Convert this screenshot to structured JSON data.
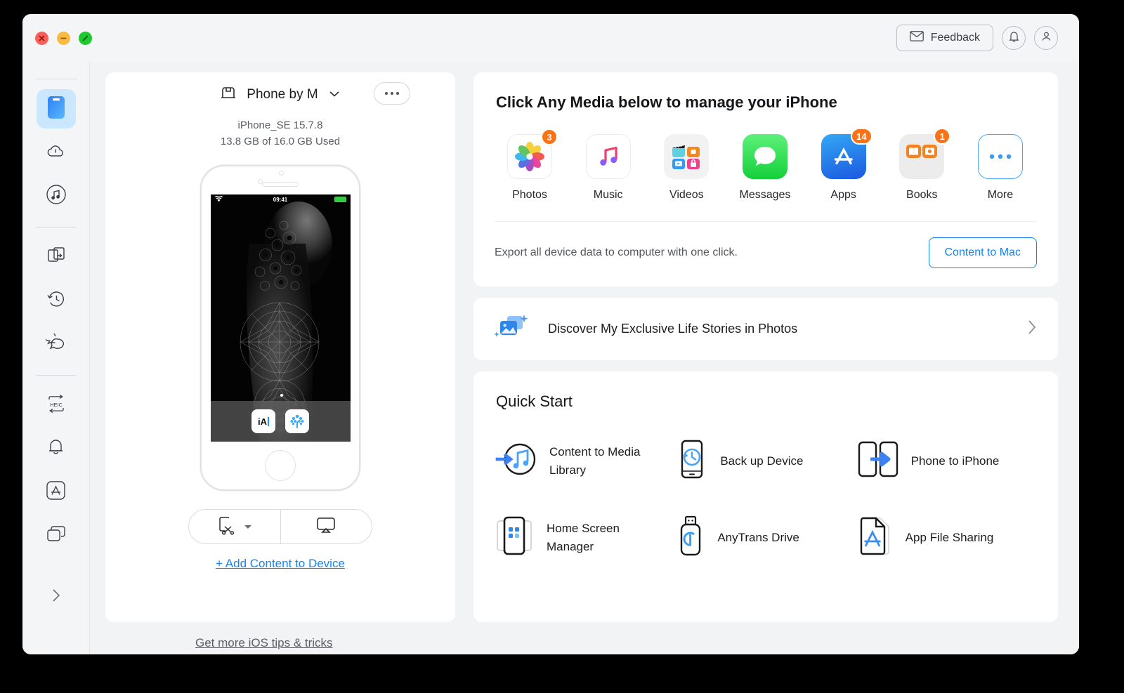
{
  "window": {
    "traffic_lights": [
      "close",
      "minimize",
      "maximize"
    ]
  },
  "titlebar": {
    "feedback_label": "Feedback",
    "notifications_icon": "bell-icon",
    "account_icon": "user-icon"
  },
  "sidebar": {
    "items": [
      {
        "icon": "device-phone-icon",
        "name": "device",
        "active": true
      },
      {
        "icon": "cloud-icon",
        "name": "cloud",
        "active": false
      },
      {
        "icon": "music-circle-icon",
        "name": "media-downloader",
        "active": false
      },
      {
        "icon": "file-transfer-icon",
        "name": "migrate",
        "active": false
      },
      {
        "icon": "clock-history-icon",
        "name": "backup-history",
        "active": false
      },
      {
        "icon": "chat-bubbles-icon",
        "name": "messages",
        "active": false
      },
      {
        "icon": "heic-converter-icon",
        "name": "heic-converter",
        "active": false
      },
      {
        "icon": "bell-icon",
        "name": "ringtone-maker",
        "active": false
      },
      {
        "icon": "app-store-icon",
        "name": "app-downloader",
        "active": false
      },
      {
        "icon": "screen-mirror-icon",
        "name": "screen-mirroring",
        "active": false
      }
    ],
    "expand_icon": "chevron-right-icon"
  },
  "device": {
    "name": "Phone by M",
    "device_icon": "device-dock-icon",
    "dropdown_icon": "chevron-down-icon",
    "more_icon": "ellipsis-icon",
    "model_line": "iPhone_SE 15.7.8",
    "storage_line": "13.8 GB of  16.0 GB Used",
    "screen": {
      "status_time": "09:41",
      "wifi_icon": "wifi-icon",
      "battery_icon": "battery-icon",
      "dock_apps": [
        "iA",
        "tree"
      ]
    },
    "actions": [
      {
        "name": "screenshot",
        "icon": "screenshot-scissors-icon",
        "has_dropdown": true
      },
      {
        "name": "airplay-mirror",
        "icon": "screen-mirror-icon",
        "has_dropdown": false
      }
    ],
    "add_content_label": "+ Add Content to Device"
  },
  "media": {
    "title": "Click Any Media below to manage your iPhone",
    "items": [
      {
        "label": "Photos",
        "icon": "photos-icon",
        "badge": "3"
      },
      {
        "label": "Music",
        "icon": "music-icon",
        "badge": null
      },
      {
        "label": "Videos",
        "icon": "videos-icon",
        "badge": null
      },
      {
        "label": "Messages",
        "icon": "messages-icon",
        "badge": null
      },
      {
        "label": "Apps",
        "icon": "apps-icon",
        "badge": "14"
      },
      {
        "label": "Books",
        "icon": "books-icon",
        "badge": "1"
      },
      {
        "label": "More",
        "icon": "more-icon",
        "badge": null
      }
    ],
    "export_text": "Export all device data to computer with one click.",
    "export_button": "Content to Mac"
  },
  "banner": {
    "icon": "photo-sparkle-icon",
    "text": "Discover My Exclusive Life Stories in Photos",
    "chevron": "chevron-right-icon"
  },
  "quick_start": {
    "title": "Quick Start",
    "items": [
      {
        "label": "Content to Media Library",
        "icon": "content-to-media-library-icon"
      },
      {
        "label": "Back up Device",
        "icon": "backup-device-icon"
      },
      {
        "label": "Phone to iPhone",
        "icon": "phone-to-iphone-icon"
      },
      {
        "label": "Home Screen Manager",
        "icon": "home-screen-manager-icon"
      },
      {
        "label": "AnyTrans Drive",
        "icon": "anytrans-drive-icon"
      },
      {
        "label": "App File Sharing",
        "icon": "app-file-sharing-icon"
      }
    ]
  },
  "footer": {
    "link": "Get more iOS tips & tricks"
  },
  "colors": {
    "accent": "#1285f5",
    "badge": "#f97316",
    "window_bg": "#f2f3f5",
    "card_bg": "#ffffff",
    "sidebar_active": "#cbe7fd"
  }
}
